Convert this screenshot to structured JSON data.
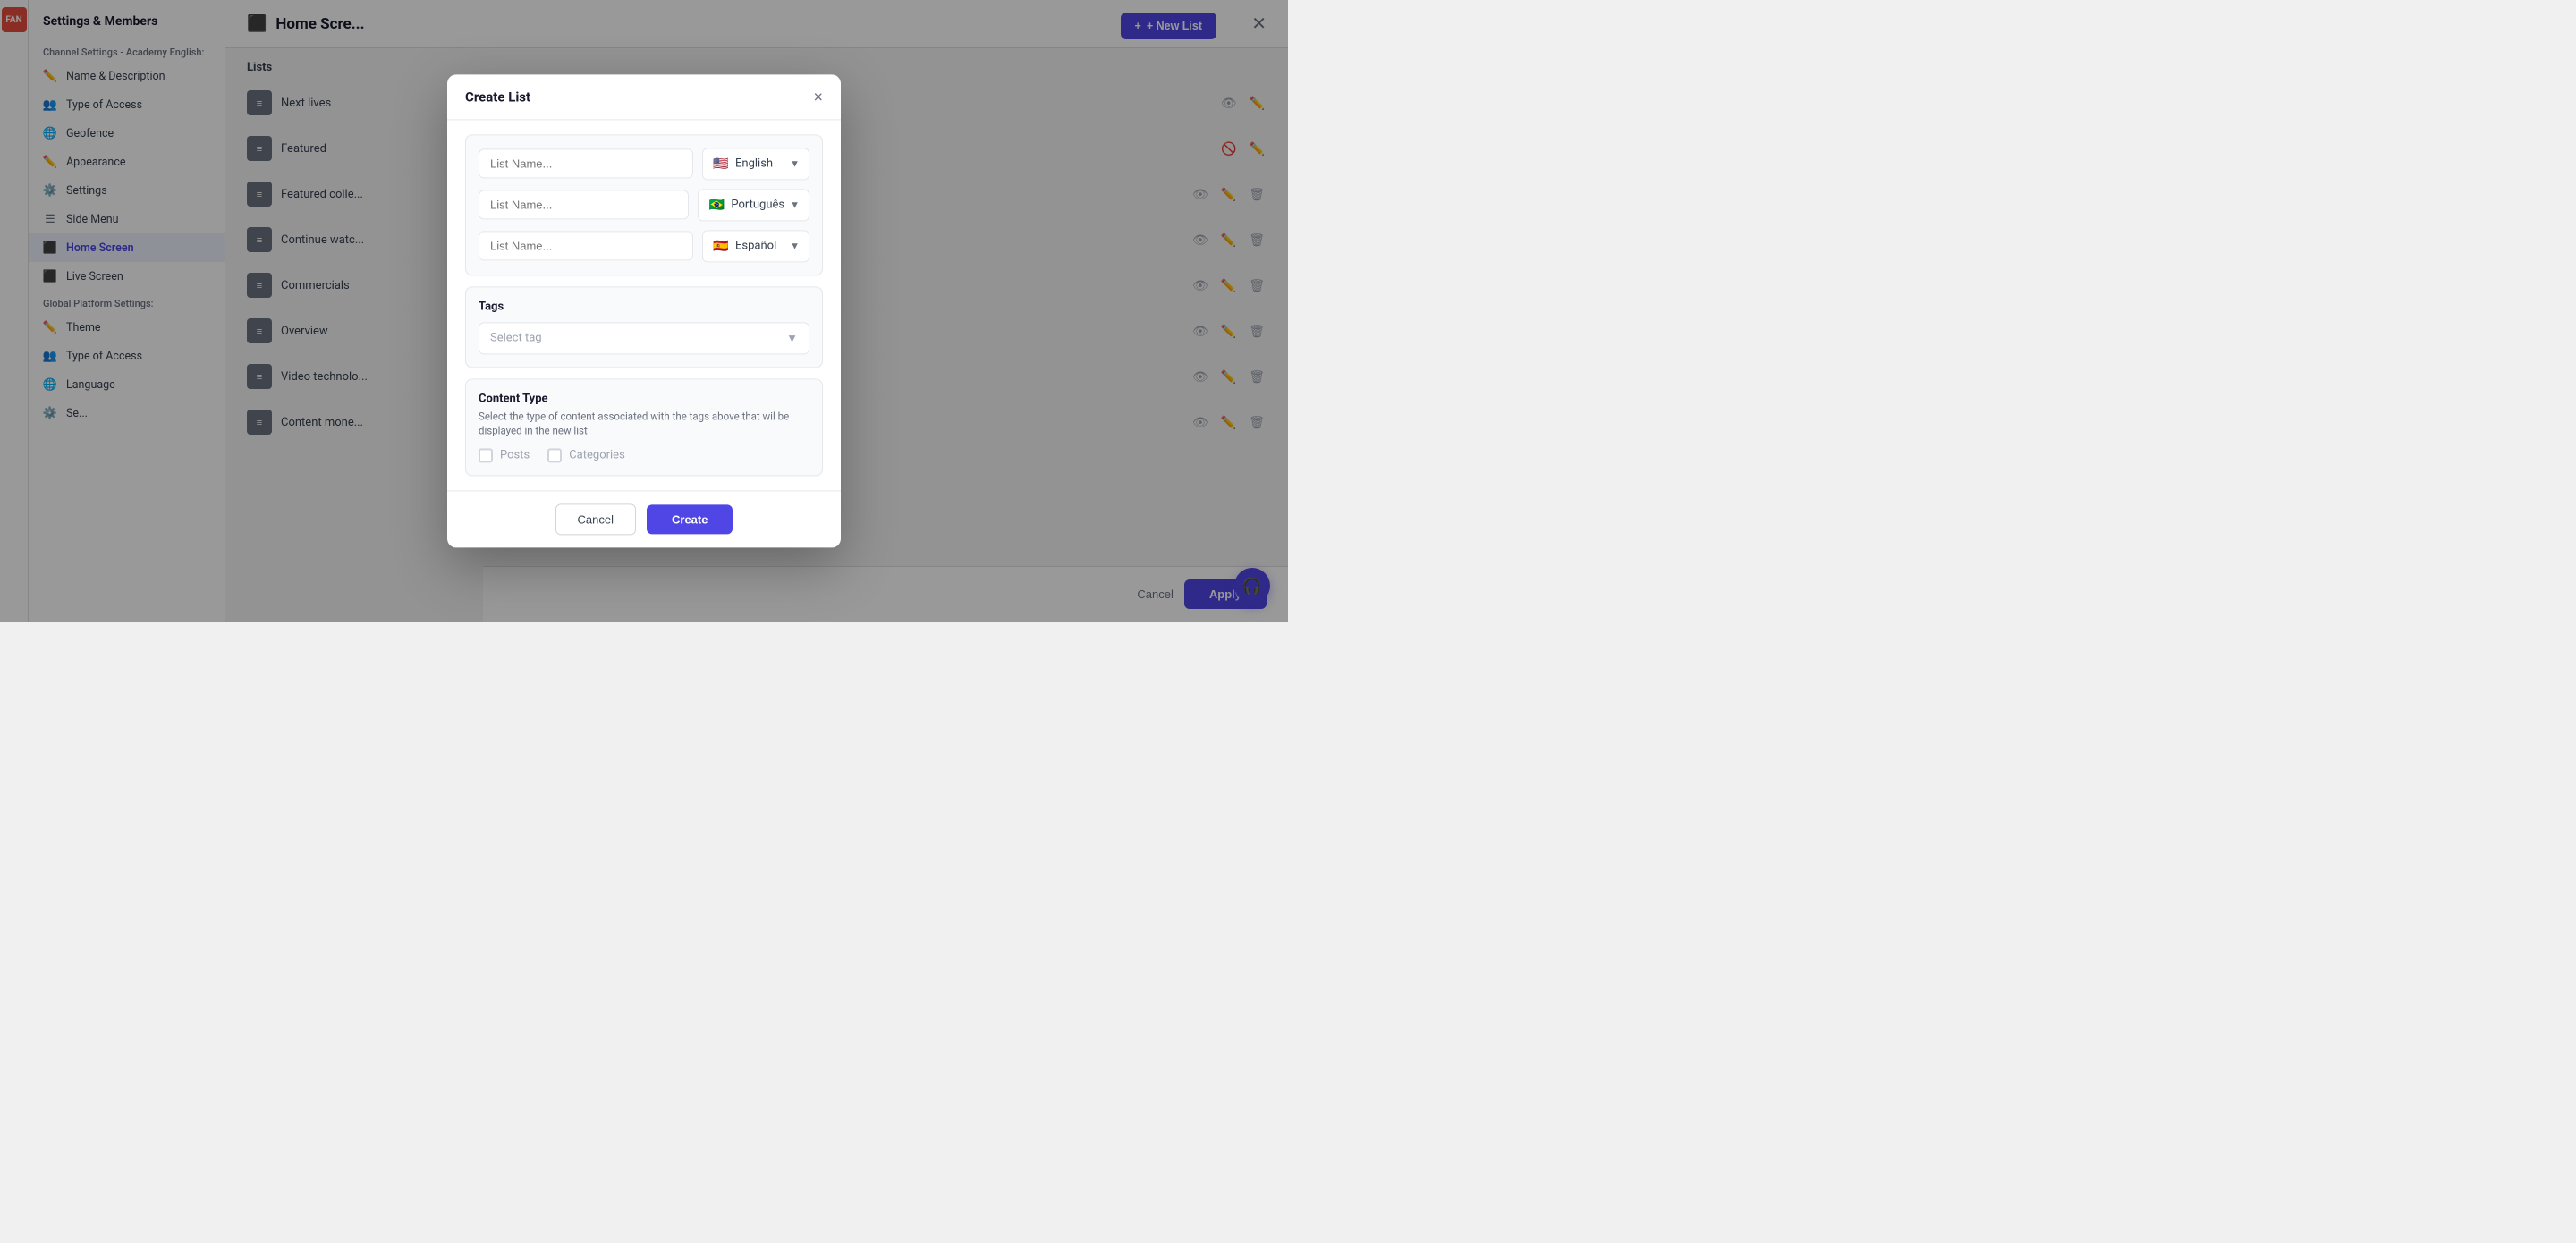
{
  "app": {
    "logo": "FAN"
  },
  "settings_panel": {
    "title": "Settings & Members",
    "channel_section": "Channel Settings - Academy English:",
    "items": [
      {
        "id": "name-description",
        "label": "Name & Description",
        "icon": "✏️"
      },
      {
        "id": "type-of-access",
        "label": "Type of Access",
        "icon": "👥"
      },
      {
        "id": "geofence",
        "label": "Geofence",
        "icon": "🌐"
      },
      {
        "id": "appearance",
        "label": "Appearance",
        "icon": "✏️"
      },
      {
        "id": "settings",
        "label": "Settings",
        "icon": "⚙️"
      },
      {
        "id": "side-menu",
        "label": "Side Menu",
        "icon": "☰"
      },
      {
        "id": "home-screen",
        "label": "Home Screen",
        "icon": "⬛",
        "active": true
      },
      {
        "id": "live-screen",
        "label": "Live Screen",
        "icon": "⬛"
      }
    ],
    "global_section": "Global Platform Settings:",
    "global_items": [
      {
        "id": "theme",
        "label": "Theme",
        "icon": "✏️"
      },
      {
        "id": "type-of-access-global",
        "label": "Type of Access",
        "icon": "👥"
      },
      {
        "id": "language",
        "label": "Language",
        "icon": "🌐"
      },
      {
        "id": "settings-global",
        "label": "Se...",
        "icon": "⚙️"
      }
    ]
  },
  "main": {
    "header_icon": "⬛",
    "title": "Home Scre...",
    "new_list_label": "+ New List",
    "lists_label": "Lists",
    "list_items": [
      {
        "name": "Next lives"
      },
      {
        "name": "Featured"
      },
      {
        "name": "Featured colle..."
      },
      {
        "name": "Continue watc..."
      },
      {
        "name": "Commercials"
      },
      {
        "name": "Overview"
      },
      {
        "name": "Video technolo..."
      },
      {
        "name": "Content mone..."
      }
    ]
  },
  "footer": {
    "cancel_label": "Cancel",
    "apply_label": "Apply"
  },
  "modal": {
    "title": "Create List",
    "close_icon": "×",
    "languages": [
      {
        "id": "english",
        "flag": "🇺🇸",
        "lang": "English",
        "placeholder": "List Name..."
      },
      {
        "id": "portuguese",
        "flag": "🇧🇷",
        "lang": "Português",
        "placeholder": "List Name..."
      },
      {
        "id": "spanish",
        "flag": "🇪🇸",
        "lang": "Español",
        "placeholder": "List Name..."
      }
    ],
    "tags_label": "Tags",
    "tags_placeholder": "Select tag",
    "content_type_title": "Content Type",
    "content_type_desc": "Select the type of content associated with the tags above that wil be displayed in the new list",
    "checkboxes": [
      {
        "id": "posts",
        "label": "Posts",
        "checked": false
      },
      {
        "id": "categories",
        "label": "Categories",
        "checked": false
      }
    ],
    "cancel_label": "Cancel",
    "create_label": "Create"
  }
}
